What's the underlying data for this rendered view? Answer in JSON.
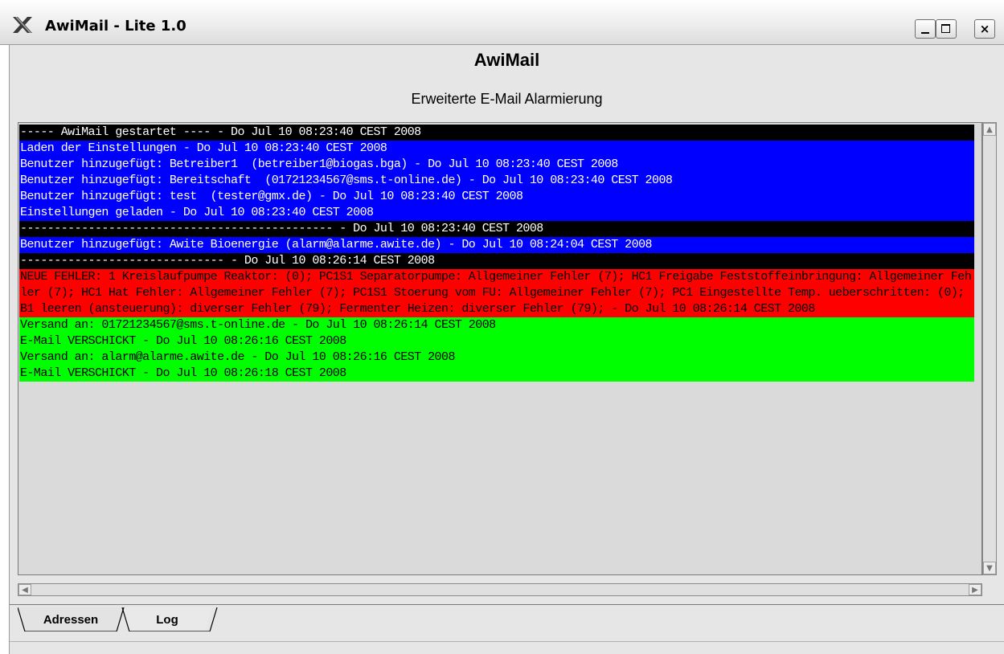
{
  "window": {
    "title": "AwiMail - Lite 1.0",
    "icons": [
      "x-logo-icon",
      "minimize-icon",
      "maximize-icon",
      "close-icon"
    ],
    "close_glyph": "×"
  },
  "header": {
    "title": "AwiMail",
    "subtitle": "Erweiterte E-Mail Alarmierung"
  },
  "log": {
    "lines": [
      "----- AwiMail gestartet ---- - Do Jul 10 08:23:40 CEST 2008",
      "Laden der Einstellungen - Do Jul 10 08:23:40 CEST 2008",
      "Benutzer hinzugefügt: Betreiber1  (betreiber1@biogas.bga) - Do Jul 10 08:23:40 CEST 2008",
      "Benutzer hinzugefügt: Bereitschaft  (01721234567@sms.t-online.de) - Do Jul 10 08:23:40 CEST 2008",
      "Benutzer hinzugefügt: test  (tester@gmx.de) - Do Jul 10 08:23:40 CEST 2008",
      "Einstellungen geladen - Do Jul 10 08:23:40 CEST 2008",
      "---------------------------------------------- - Do Jul 10 08:23:40 CEST 2008",
      "Benutzer hinzugefügt: Awite Bioenergie (alarm@alarme.awite.de) - Do Jul 10 08:24:04 CEST 2008",
      "------------------------------ - Do Jul 10 08:26:14 CEST 2008",
      "NEUE FEHLER: 1 Kreislaufpumpe Reaktor:  (0); PC1S1 Separatorpumpe: Allgemeiner Fehler (7); HC1 Freigabe Feststoffeinbringung: Allgemeiner Fehler (7); HC1 Hat Fehler: Allgemeiner Fehler (7); PC1S1 Stoerung vom FU: Allgemeiner Fehler (7); PC1 Eingestellte Temp. ueberschritten:  (0); B1 leeren (ansteuerung): diverser Fehler (79); Fermenter Heizen: diverser Fehler (79); - Do Jul 10 08:26:14 CEST 2008",
      "Versand an: 01721234567@sms.t-online.de - Do Jul 10 08:26:14 CEST 2008",
      "E-Mail VERSCHICKT - Do Jul 10 08:26:16 CEST 2008",
      "Versand an: alarm@alarme.awite.de - Do Jul 10 08:26:16 CEST 2008",
      "E-Mail VERSCHICKT - Do Jul 10 08:26:18 CEST 2008"
    ],
    "colors": {
      "separator": "#000000",
      "info": "#0000ff",
      "error": "#ff0000",
      "sent": "#00ff00"
    }
  },
  "tabs": [
    {
      "label": "Adressen",
      "active": false
    },
    {
      "label": "Log",
      "active": true
    }
  ]
}
